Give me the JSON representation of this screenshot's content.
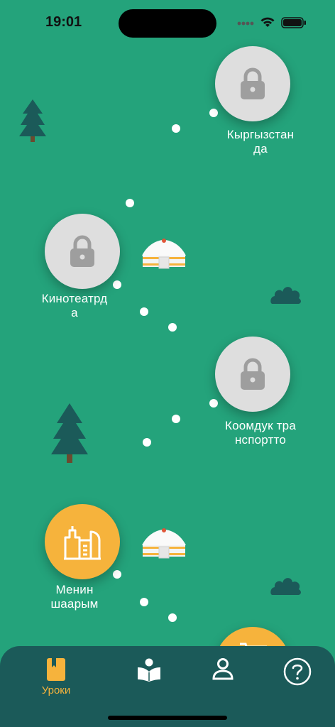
{
  "status_bar": {
    "time": "19:01"
  },
  "lessons": [
    {
      "title_line1": "Кыргызстан",
      "title_line2": "да",
      "state": "locked",
      "icon": "lock-icon"
    },
    {
      "title_line1": "Кинотеатрд",
      "title_line2": "а",
      "state": "locked",
      "icon": "lock-icon"
    },
    {
      "title_line1": "Коомдук тра",
      "title_line2": "нспортто",
      "state": "locked",
      "icon": "lock-icon"
    },
    {
      "title_line1": "Менин",
      "title_line2": "шаарым",
      "state": "open",
      "icon": "city-icon"
    },
    {
      "title_line1": "",
      "title_line2": "",
      "state": "open",
      "icon": "cart-icon"
    }
  ],
  "tabbar": {
    "tabs": [
      {
        "label": "Уроки",
        "icon": "bookmark-book-icon",
        "active": true
      },
      {
        "label": "",
        "icon": "reading-person-icon",
        "active": false
      },
      {
        "label": "",
        "icon": "profile-icon",
        "active": false
      },
      {
        "label": "",
        "icon": "help-icon",
        "active": false
      }
    ]
  },
  "colors": {
    "background": "#24a37b",
    "locked_node": "#dedede",
    "open_node": "#f6b33c",
    "tabbar": "#1b5a59",
    "active_tab": "#f6b33c"
  }
}
